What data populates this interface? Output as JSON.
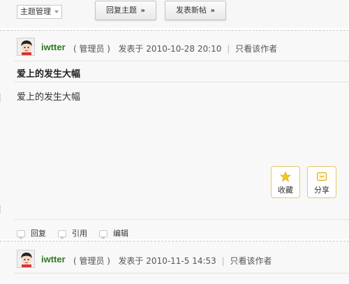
{
  "toolbar": {
    "topic_manage": "主题管理",
    "reply_button": "回复主题",
    "new_post_button": "发表新帖",
    "chevron": "»"
  },
  "posts": [
    {
      "author": "iwtter",
      "role": "( 管理员 )",
      "posted_prefix": "发表于",
      "datetime": "2010-10-28 20:10",
      "separator": "|",
      "only_author": "只看该作者",
      "title": "爱上的发生大幅",
      "body": "爱上的发生大幅",
      "favorite_label": "收藏",
      "share_label": "分享",
      "reply_label": "回复",
      "quote_label": "引用",
      "edit_label": "编辑"
    },
    {
      "author": "iwtter",
      "role": "( 管理员 )",
      "posted_prefix": "发表于",
      "datetime": "2010-11-5 14:53",
      "separator": "|",
      "only_author": "只看该作者"
    }
  ],
  "colors": {
    "author": "#2a7a1c",
    "action_border": "#e4c96a",
    "star": "#f3c623"
  },
  "icons": [
    "chevron-down-icon",
    "avatar-icon",
    "star-icon",
    "share-icon",
    "reply-icon",
    "quote-icon",
    "edit-icon"
  ]
}
